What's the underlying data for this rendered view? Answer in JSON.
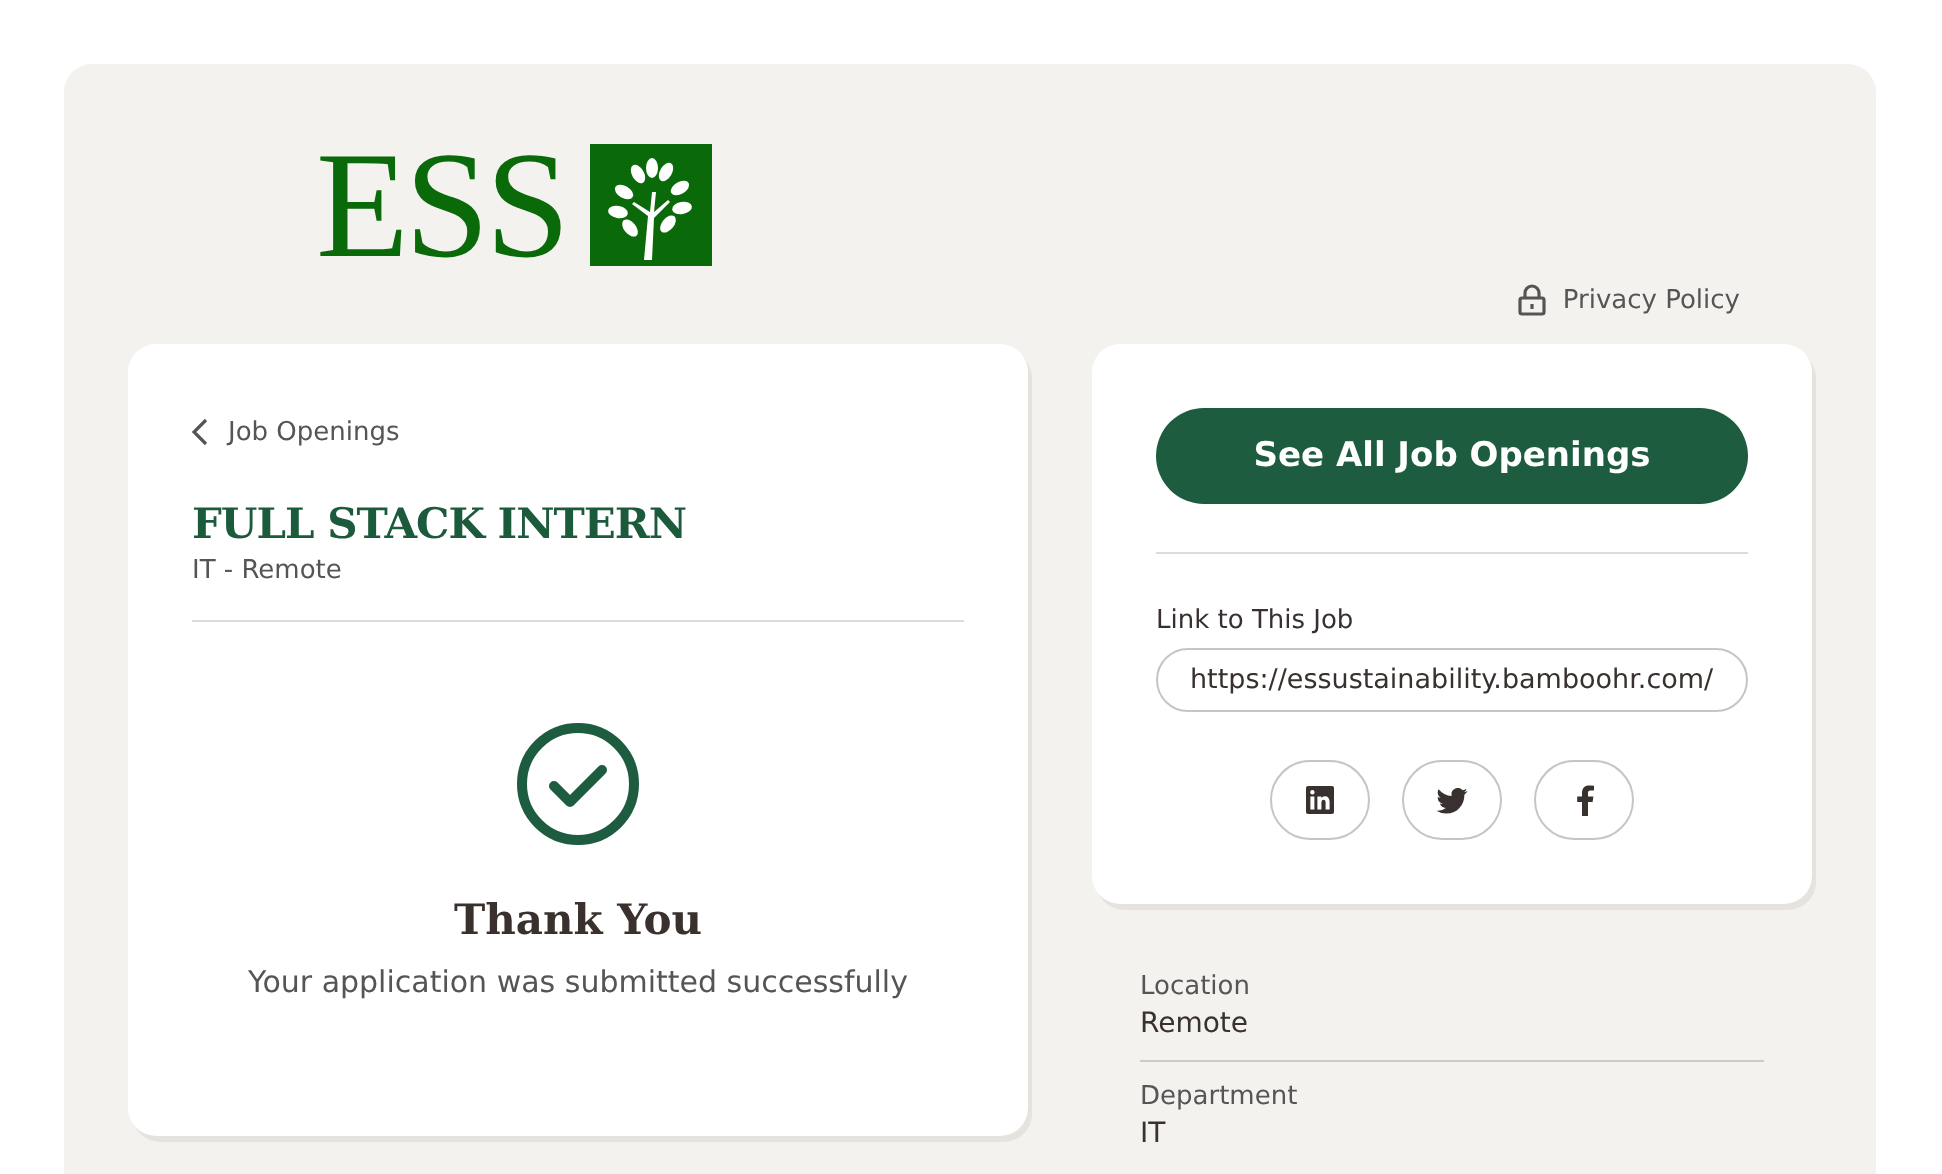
{
  "logo": {
    "text": "ESS"
  },
  "privacy_link": "Privacy Policy",
  "job_card": {
    "back_link": "Job Openings",
    "title": "FULL STACK INTERN",
    "subtitle": "IT - Remote",
    "confirmation_title": "Thank You",
    "confirmation_message": "Your application was submitted successfully"
  },
  "share_card": {
    "button": "See All Job Openings",
    "link_label": "Link to This Job",
    "link_value": "https://essustainability.bamboohr.com/",
    "social": [
      {
        "kind": "linkedin"
      },
      {
        "kind": "twitter"
      },
      {
        "kind": "facebook"
      }
    ]
  },
  "details": [
    {
      "label": "Location",
      "value": "Remote"
    },
    {
      "label": "Department",
      "value": "IT"
    }
  ]
}
